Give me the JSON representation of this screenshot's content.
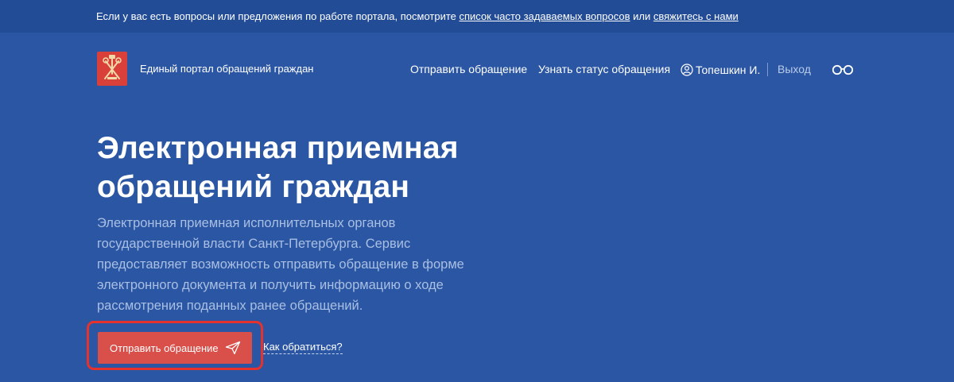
{
  "topbar": {
    "text_before": "Если у вас есть вопросы или предложения по работе портала, посмотрите ",
    "faq_link": "список часто задаваемых вопросов",
    "text_middle": " или ",
    "contact_link": "свяжитесь с нами"
  },
  "header": {
    "logo_icon": "spb-coat-of-arms-icon",
    "portal_name": "Единый портал обращений граждан",
    "nav": {
      "send": "Отправить обращение",
      "status": "Узнать статус обращения"
    },
    "user": {
      "icon": "user-icon",
      "name": "Топешкин И."
    },
    "logout": "Выход",
    "accessibility_icon": "glasses-icon"
  },
  "hero": {
    "title_line1": "Электронная приемная",
    "title_line2": "обращений граждан",
    "description": "Электронная приемная исполнительных органов государственной власти Санкт-Петербурга. Сервис предоставляет возможность отправить обращение в форме электронного документа и получить информацию о ходе рассмотрения поданных ранее обращений.",
    "send_button": "Отправить обращение",
    "send_icon": "paper-plane-icon",
    "how_link": "Как обратиться?"
  },
  "colors": {
    "background": "#2b56a3",
    "topbar": "#234c96",
    "accent_button": "#d94f4a",
    "highlight_ring": "#e5322d",
    "logo": "#d9403a"
  }
}
